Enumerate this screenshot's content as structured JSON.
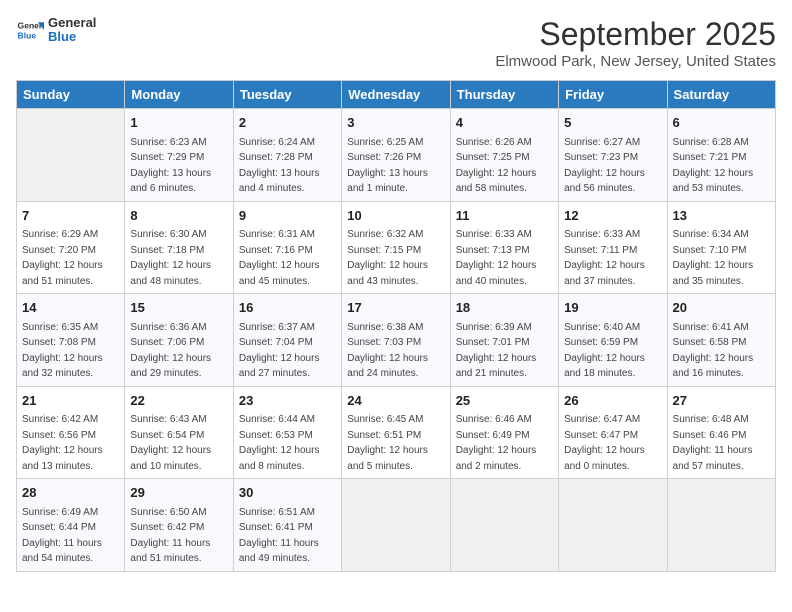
{
  "logo": {
    "text_general": "General",
    "text_blue": "Blue"
  },
  "title": "September 2025",
  "subtitle": "Elmwood Park, New Jersey, United States",
  "days_of_week": [
    "Sunday",
    "Monday",
    "Tuesday",
    "Wednesday",
    "Thursday",
    "Friday",
    "Saturday"
  ],
  "weeks": [
    [
      {
        "date": "",
        "info": ""
      },
      {
        "date": "1",
        "info": "Sunrise: 6:23 AM\nSunset: 7:29 PM\nDaylight: 13 hours\nand 6 minutes."
      },
      {
        "date": "2",
        "info": "Sunrise: 6:24 AM\nSunset: 7:28 PM\nDaylight: 13 hours\nand 4 minutes."
      },
      {
        "date": "3",
        "info": "Sunrise: 6:25 AM\nSunset: 7:26 PM\nDaylight: 13 hours\nand 1 minute."
      },
      {
        "date": "4",
        "info": "Sunrise: 6:26 AM\nSunset: 7:25 PM\nDaylight: 12 hours\nand 58 minutes."
      },
      {
        "date": "5",
        "info": "Sunrise: 6:27 AM\nSunset: 7:23 PM\nDaylight: 12 hours\nand 56 minutes."
      },
      {
        "date": "6",
        "info": "Sunrise: 6:28 AM\nSunset: 7:21 PM\nDaylight: 12 hours\nand 53 minutes."
      }
    ],
    [
      {
        "date": "7",
        "info": "Sunrise: 6:29 AM\nSunset: 7:20 PM\nDaylight: 12 hours\nand 51 minutes."
      },
      {
        "date": "8",
        "info": "Sunrise: 6:30 AM\nSunset: 7:18 PM\nDaylight: 12 hours\nand 48 minutes."
      },
      {
        "date": "9",
        "info": "Sunrise: 6:31 AM\nSunset: 7:16 PM\nDaylight: 12 hours\nand 45 minutes."
      },
      {
        "date": "10",
        "info": "Sunrise: 6:32 AM\nSunset: 7:15 PM\nDaylight: 12 hours\nand 43 minutes."
      },
      {
        "date": "11",
        "info": "Sunrise: 6:33 AM\nSunset: 7:13 PM\nDaylight: 12 hours\nand 40 minutes."
      },
      {
        "date": "12",
        "info": "Sunrise: 6:33 AM\nSunset: 7:11 PM\nDaylight: 12 hours\nand 37 minutes."
      },
      {
        "date": "13",
        "info": "Sunrise: 6:34 AM\nSunset: 7:10 PM\nDaylight: 12 hours\nand 35 minutes."
      }
    ],
    [
      {
        "date": "14",
        "info": "Sunrise: 6:35 AM\nSunset: 7:08 PM\nDaylight: 12 hours\nand 32 minutes."
      },
      {
        "date": "15",
        "info": "Sunrise: 6:36 AM\nSunset: 7:06 PM\nDaylight: 12 hours\nand 29 minutes."
      },
      {
        "date": "16",
        "info": "Sunrise: 6:37 AM\nSunset: 7:04 PM\nDaylight: 12 hours\nand 27 minutes."
      },
      {
        "date": "17",
        "info": "Sunrise: 6:38 AM\nSunset: 7:03 PM\nDaylight: 12 hours\nand 24 minutes."
      },
      {
        "date": "18",
        "info": "Sunrise: 6:39 AM\nSunset: 7:01 PM\nDaylight: 12 hours\nand 21 minutes."
      },
      {
        "date": "19",
        "info": "Sunrise: 6:40 AM\nSunset: 6:59 PM\nDaylight: 12 hours\nand 18 minutes."
      },
      {
        "date": "20",
        "info": "Sunrise: 6:41 AM\nSunset: 6:58 PM\nDaylight: 12 hours\nand 16 minutes."
      }
    ],
    [
      {
        "date": "21",
        "info": "Sunrise: 6:42 AM\nSunset: 6:56 PM\nDaylight: 12 hours\nand 13 minutes."
      },
      {
        "date": "22",
        "info": "Sunrise: 6:43 AM\nSunset: 6:54 PM\nDaylight: 12 hours\nand 10 minutes."
      },
      {
        "date": "23",
        "info": "Sunrise: 6:44 AM\nSunset: 6:53 PM\nDaylight: 12 hours\nand 8 minutes."
      },
      {
        "date": "24",
        "info": "Sunrise: 6:45 AM\nSunset: 6:51 PM\nDaylight: 12 hours\nand 5 minutes."
      },
      {
        "date": "25",
        "info": "Sunrise: 6:46 AM\nSunset: 6:49 PM\nDaylight: 12 hours\nand 2 minutes."
      },
      {
        "date": "26",
        "info": "Sunrise: 6:47 AM\nSunset: 6:47 PM\nDaylight: 12 hours\nand 0 minutes."
      },
      {
        "date": "27",
        "info": "Sunrise: 6:48 AM\nSunset: 6:46 PM\nDaylight: 11 hours\nand 57 minutes."
      }
    ],
    [
      {
        "date": "28",
        "info": "Sunrise: 6:49 AM\nSunset: 6:44 PM\nDaylight: 11 hours\nand 54 minutes."
      },
      {
        "date": "29",
        "info": "Sunrise: 6:50 AM\nSunset: 6:42 PM\nDaylight: 11 hours\nand 51 minutes."
      },
      {
        "date": "30",
        "info": "Sunrise: 6:51 AM\nSunset: 6:41 PM\nDaylight: 11 hours\nand 49 minutes."
      },
      {
        "date": "",
        "info": ""
      },
      {
        "date": "",
        "info": ""
      },
      {
        "date": "",
        "info": ""
      },
      {
        "date": "",
        "info": ""
      }
    ]
  ]
}
